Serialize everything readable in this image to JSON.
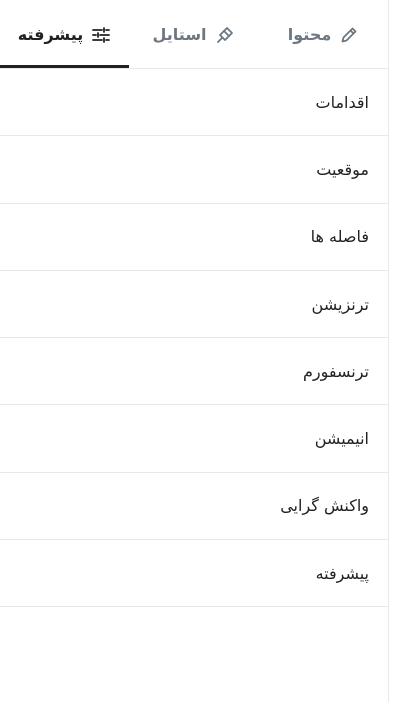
{
  "tabs": {
    "content": {
      "label": "محتوا",
      "icon": "pencil-icon"
    },
    "style": {
      "label": "استایل",
      "icon": "brush-icon"
    },
    "advanced": {
      "label": "پیشرفته",
      "icon": "sliders-icon",
      "active": true
    }
  },
  "sections": [
    {
      "label": "اقدامات"
    },
    {
      "label": "موقعیت"
    },
    {
      "label": "فاصله ها"
    },
    {
      "label": "ترنزیشن"
    },
    {
      "label": "ترنسفورم"
    },
    {
      "label": "انیمیشن"
    },
    {
      "label": "واکنش گرایی"
    },
    {
      "label": "پیشرفته"
    }
  ]
}
